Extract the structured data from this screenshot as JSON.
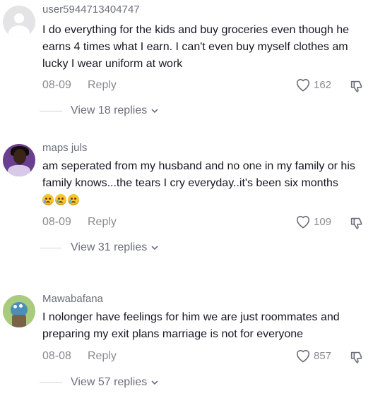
{
  "comments": [
    {
      "username": "user5944713404747",
      "text": "I do everything for the kids and buy groceries even though he earns 4 times what I earn. I can't even buy myself clothes am lucky I wear uniform at work",
      "date": "08-09",
      "reply_label": "Reply",
      "likes": "162",
      "view_replies": "View 18 replies",
      "avatar": "default-avatar"
    },
    {
      "username": "maps juls",
      "text": "am seperated from my husband and no one in my family or his family knows...the tears I cry everyday..it's been six months",
      "emojis": [
        "crying-face",
        "crying-face",
        "crying-face"
      ],
      "date": "08-09",
      "reply_label": "Reply",
      "likes": "109",
      "view_replies": "View 31 replies",
      "avatar": "photo-avatar"
    },
    {
      "username": "Mawabafana",
      "text": "I nolonger have feelings for him we are just roommates and preparing my exit plans marriage is not for everyone",
      "date": "08-08",
      "reply_label": "Reply",
      "likes": "857",
      "view_replies": "View 57 replies",
      "avatar": "cartoon-avatar"
    }
  ],
  "icons": {
    "like": "heart-outline-icon",
    "dislike": "thumbs-down-icon",
    "expand": "chevron-down-icon"
  },
  "colors": {
    "text": "#161823",
    "muted": "#8a8b91",
    "background": "#ffffff"
  }
}
